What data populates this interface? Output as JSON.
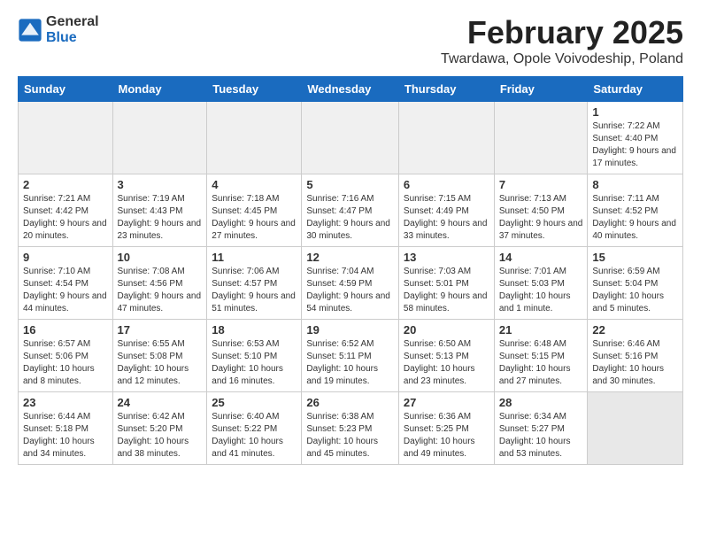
{
  "logo": {
    "general": "General",
    "blue": "Blue"
  },
  "header": {
    "month": "February 2025",
    "location": "Twardawa, Opole Voivodeship, Poland"
  },
  "weekdays": [
    "Sunday",
    "Monday",
    "Tuesday",
    "Wednesday",
    "Thursday",
    "Friday",
    "Saturday"
  ],
  "weeks": [
    [
      {
        "day": "",
        "info": "",
        "empty": true
      },
      {
        "day": "",
        "info": "",
        "empty": true
      },
      {
        "day": "",
        "info": "",
        "empty": true
      },
      {
        "day": "",
        "info": "",
        "empty": true
      },
      {
        "day": "",
        "info": "",
        "empty": true
      },
      {
        "day": "",
        "info": "",
        "empty": true
      },
      {
        "day": "1",
        "info": "Sunrise: 7:22 AM\nSunset: 4:40 PM\nDaylight: 9 hours and 17 minutes.",
        "empty": false
      }
    ],
    [
      {
        "day": "2",
        "info": "Sunrise: 7:21 AM\nSunset: 4:42 PM\nDaylight: 9 hours and 20 minutes.",
        "empty": false
      },
      {
        "day": "3",
        "info": "Sunrise: 7:19 AM\nSunset: 4:43 PM\nDaylight: 9 hours and 23 minutes.",
        "empty": false
      },
      {
        "day": "4",
        "info": "Sunrise: 7:18 AM\nSunset: 4:45 PM\nDaylight: 9 hours and 27 minutes.",
        "empty": false
      },
      {
        "day": "5",
        "info": "Sunrise: 7:16 AM\nSunset: 4:47 PM\nDaylight: 9 hours and 30 minutes.",
        "empty": false
      },
      {
        "day": "6",
        "info": "Sunrise: 7:15 AM\nSunset: 4:49 PM\nDaylight: 9 hours and 33 minutes.",
        "empty": false
      },
      {
        "day": "7",
        "info": "Sunrise: 7:13 AM\nSunset: 4:50 PM\nDaylight: 9 hours and 37 minutes.",
        "empty": false
      },
      {
        "day": "8",
        "info": "Sunrise: 7:11 AM\nSunset: 4:52 PM\nDaylight: 9 hours and 40 minutes.",
        "empty": false
      }
    ],
    [
      {
        "day": "9",
        "info": "Sunrise: 7:10 AM\nSunset: 4:54 PM\nDaylight: 9 hours and 44 minutes.",
        "empty": false
      },
      {
        "day": "10",
        "info": "Sunrise: 7:08 AM\nSunset: 4:56 PM\nDaylight: 9 hours and 47 minutes.",
        "empty": false
      },
      {
        "day": "11",
        "info": "Sunrise: 7:06 AM\nSunset: 4:57 PM\nDaylight: 9 hours and 51 minutes.",
        "empty": false
      },
      {
        "day": "12",
        "info": "Sunrise: 7:04 AM\nSunset: 4:59 PM\nDaylight: 9 hours and 54 minutes.",
        "empty": false
      },
      {
        "day": "13",
        "info": "Sunrise: 7:03 AM\nSunset: 5:01 PM\nDaylight: 9 hours and 58 minutes.",
        "empty": false
      },
      {
        "day": "14",
        "info": "Sunrise: 7:01 AM\nSunset: 5:03 PM\nDaylight: 10 hours and 1 minute.",
        "empty": false
      },
      {
        "day": "15",
        "info": "Sunrise: 6:59 AM\nSunset: 5:04 PM\nDaylight: 10 hours and 5 minutes.",
        "empty": false
      }
    ],
    [
      {
        "day": "16",
        "info": "Sunrise: 6:57 AM\nSunset: 5:06 PM\nDaylight: 10 hours and 8 minutes.",
        "empty": false
      },
      {
        "day": "17",
        "info": "Sunrise: 6:55 AM\nSunset: 5:08 PM\nDaylight: 10 hours and 12 minutes.",
        "empty": false
      },
      {
        "day": "18",
        "info": "Sunrise: 6:53 AM\nSunset: 5:10 PM\nDaylight: 10 hours and 16 minutes.",
        "empty": false
      },
      {
        "day": "19",
        "info": "Sunrise: 6:52 AM\nSunset: 5:11 PM\nDaylight: 10 hours and 19 minutes.",
        "empty": false
      },
      {
        "day": "20",
        "info": "Sunrise: 6:50 AM\nSunset: 5:13 PM\nDaylight: 10 hours and 23 minutes.",
        "empty": false
      },
      {
        "day": "21",
        "info": "Sunrise: 6:48 AM\nSunset: 5:15 PM\nDaylight: 10 hours and 27 minutes.",
        "empty": false
      },
      {
        "day": "22",
        "info": "Sunrise: 6:46 AM\nSunset: 5:16 PM\nDaylight: 10 hours and 30 minutes.",
        "empty": false
      }
    ],
    [
      {
        "day": "23",
        "info": "Sunrise: 6:44 AM\nSunset: 5:18 PM\nDaylight: 10 hours and 34 minutes.",
        "empty": false
      },
      {
        "day": "24",
        "info": "Sunrise: 6:42 AM\nSunset: 5:20 PM\nDaylight: 10 hours and 38 minutes.",
        "empty": false
      },
      {
        "day": "25",
        "info": "Sunrise: 6:40 AM\nSunset: 5:22 PM\nDaylight: 10 hours and 41 minutes.",
        "empty": false
      },
      {
        "day": "26",
        "info": "Sunrise: 6:38 AM\nSunset: 5:23 PM\nDaylight: 10 hours and 45 minutes.",
        "empty": false
      },
      {
        "day": "27",
        "info": "Sunrise: 6:36 AM\nSunset: 5:25 PM\nDaylight: 10 hours and 49 minutes.",
        "empty": false
      },
      {
        "day": "28",
        "info": "Sunrise: 6:34 AM\nSunset: 5:27 PM\nDaylight: 10 hours and 53 minutes.",
        "empty": false
      },
      {
        "day": "",
        "info": "",
        "empty": true,
        "shaded": true
      }
    ]
  ]
}
